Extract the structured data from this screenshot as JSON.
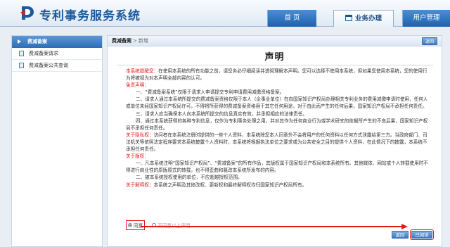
{
  "header": {
    "site_title": "专利事务服务系统",
    "nav": {
      "home": "首 页",
      "business": "业务办理",
      "user_mgmt": "用户管理"
    }
  },
  "sidebar": {
    "heading": "费减备案",
    "items": [
      {
        "label": "费减备案请求"
      },
      {
        "label": "费减备案公共查询"
      }
    ]
  },
  "breadcrumb": {
    "section": "费减备案",
    "separator": ">",
    "page": "新增",
    "back_label": "返回"
  },
  "declaration": {
    "title": "声明",
    "p1_prefix": "本系统提醒您：",
    "p1_text": "在使用本系统的所有功能之前，请您务必仔细阅读并透彻理解本声明。您可以选择不使用本系统，但如果您使用本系统，您的使用行为将被视为对本声明全部内容的认可。",
    "disclaimer_heading": "免责声明：",
    "items": [
      "一、“费减备案系统”仅限于请求人申请提交专利申请费用减缴资格备案。",
      "二、请求人通过本系统所提交的费减备案资格仅限于本人（企事业单位）在向国家知识产权局办理相关专利业务的费用减缴申请时使用，任何人或单位未经国家知识产权局许可，不得将所获得的费减备案资格用于其它任何用途，对于由此而产生的任何后果，国家知识产权局不承担任何责任。",
      "三、请求人应当确保本人向本系统所提交的信息真实有效，并承担相应的法律责任。",
      "四、通过本系统获得的各种专利信息，仅作为专利事务处理之用，并对其作为任何商业行为或学术研究的依据所产生的不良后果，国家知识产权局不承担任何责任。"
    ],
    "privacy_heading": "关于隐私权：",
    "privacy_text": "访问者在本系统注册时提供的一些个人资料，本系统除您本人同意外不会将用户的任何资料以任何方式泄露给第三方。当政府部门、司法机关等依照法定程序要求本系统披露个人资料时，本系统将根据执法单位之要求或为公共安全之目的提供个人资料，在此情况下的披露，本系统不承担任何责任。",
    "copyright_heading": "关于版权：",
    "copyright_items": [
      "一、凡本系统注明“国家知识产权局”、“费减备案”的所有作品，其版权属于国家知识产权局和本系统所有。其他媒体、网站或个人转载使用时不得进行商业性的原版原式的转载，也不得歪曲和篡改本系统所发布的内容。",
      "二、被本系统授权使用的单位，不应超越授权范围。"
    ],
    "interpret_heading": "关于解释权：",
    "interpret_text": "本系统之声明及其修改权、更新权和最终解释权均归国家知识产权局所有。"
  },
  "consent": {
    "agree_label": "同意",
    "disagree_label": "不同意以上声明",
    "selected": "agree"
  },
  "buttons": {
    "back": "返回",
    "read": "已阅读"
  },
  "colors": {
    "brand_blue": "#1b5a9c",
    "warning_red": "#e21b1b",
    "annotation_red": "#e01818"
  }
}
